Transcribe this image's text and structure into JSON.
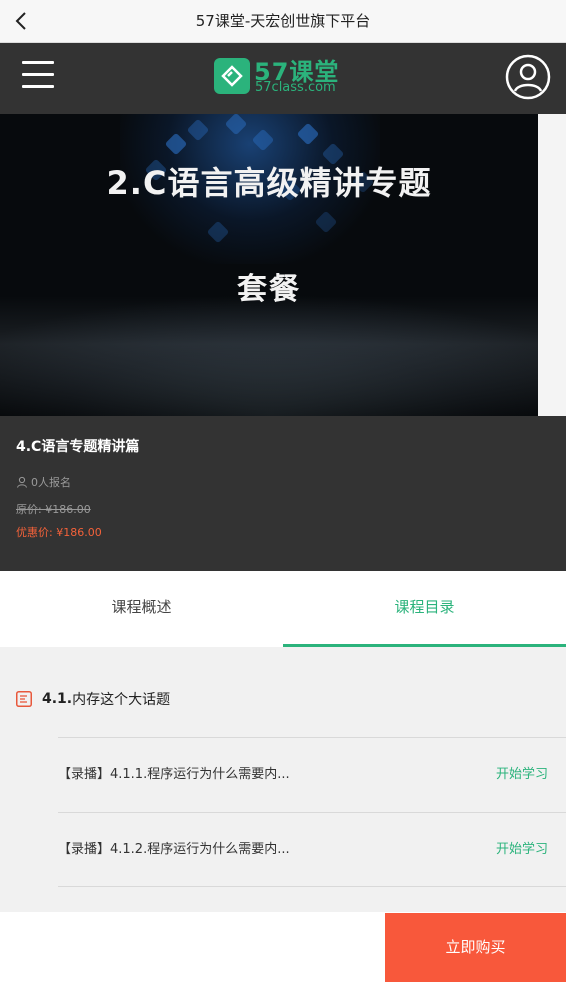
{
  "titlebar": {
    "title": "57课堂-天宏创世旗下平台",
    "back_icon": "chevron-left-icon"
  },
  "header": {
    "menu_icon": "hamburger-menu-icon",
    "logo": {
      "title": "57课堂",
      "subtitle": "57class.com",
      "icon": "57class-logo-icon"
    },
    "user_icon": "user-circle-icon"
  },
  "banner": {
    "line1": "2.C语言高级精讲专题",
    "line2": "套餐"
  },
  "course": {
    "title": "4.C语言专题精讲篇",
    "enroll_text": "0人报名",
    "original_price": "原价: ¥186.00",
    "sale_price": "优惠价: ¥186.00"
  },
  "tabs": [
    {
      "label": "课程概述",
      "active": false
    },
    {
      "label": "课程目录",
      "active": true
    }
  ],
  "catalog": {
    "chapter": {
      "number": "4.1.",
      "name": "内存这个大话题"
    },
    "lessons": [
      {
        "text": "【录播】4.1.1.程序运行为什么需要内...",
        "action": "开始学习"
      },
      {
        "text": "【录播】4.1.2.程序运行为什么需要内...",
        "action": "开始学习"
      }
    ]
  },
  "bottom": {
    "buy_label": "立即购买"
  },
  "colors": {
    "accent_green": "#2bb37c",
    "buy_red": "#f8583b",
    "price_red": "#f4623a",
    "dark_bg": "#333333"
  }
}
